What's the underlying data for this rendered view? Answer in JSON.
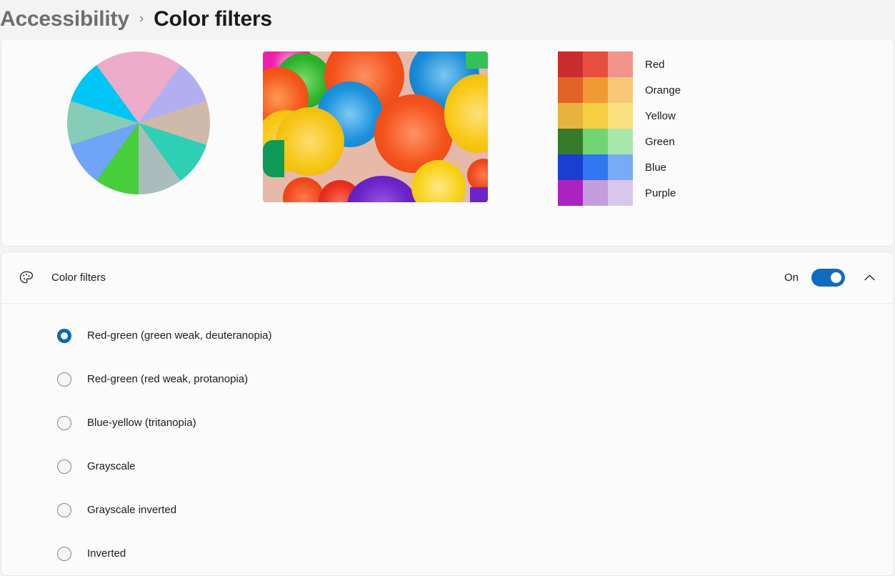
{
  "breadcrumb": {
    "parent": "Accessibility",
    "separator": "›",
    "current": "Color filters"
  },
  "preview": {
    "wheel_icon": "color-wheel",
    "photo_icon": "paper-fans-photo",
    "swatches": [
      {
        "label": "Red",
        "colors": [
          "#c92e2e",
          "#e84e3e",
          "#f0948c"
        ]
      },
      {
        "label": "Orange",
        "colors": [
          "#e06226",
          "#f09a36",
          "#f8c877"
        ]
      },
      {
        "label": "Yellow",
        "colors": [
          "#e8b33c",
          "#f8ce42",
          "#fae17e"
        ]
      },
      {
        "label": "Green",
        "colors": [
          "#357b2a",
          "#72d472",
          "#a9e6ac"
        ]
      },
      {
        "label": "Blue",
        "colors": [
          "#1a3ed0",
          "#3176f2",
          "#77abf5"
        ]
      },
      {
        "label": "Purple",
        "colors": [
          "#ac22c0",
          "#c39ddc",
          "#d9c6ec"
        ]
      }
    ]
  },
  "setting": {
    "icon": "palette-icon",
    "title": "Color filters",
    "toggle_state": "On",
    "toggle_on": true,
    "expand_icon": "chevron-up-icon",
    "accent_color": "#0067c0"
  },
  "filters": {
    "selected_index": 0,
    "options": [
      {
        "label": "Red-green (green weak, deuteranopia)",
        "selected": true
      },
      {
        "label": "Red-green (red weak, protanopia)",
        "selected": false
      },
      {
        "label": "Blue-yellow (tritanopia)",
        "selected": false
      },
      {
        "label": "Grayscale",
        "selected": false
      },
      {
        "label": "Grayscale inverted",
        "selected": false
      },
      {
        "label": "Inverted",
        "selected": false
      }
    ]
  }
}
